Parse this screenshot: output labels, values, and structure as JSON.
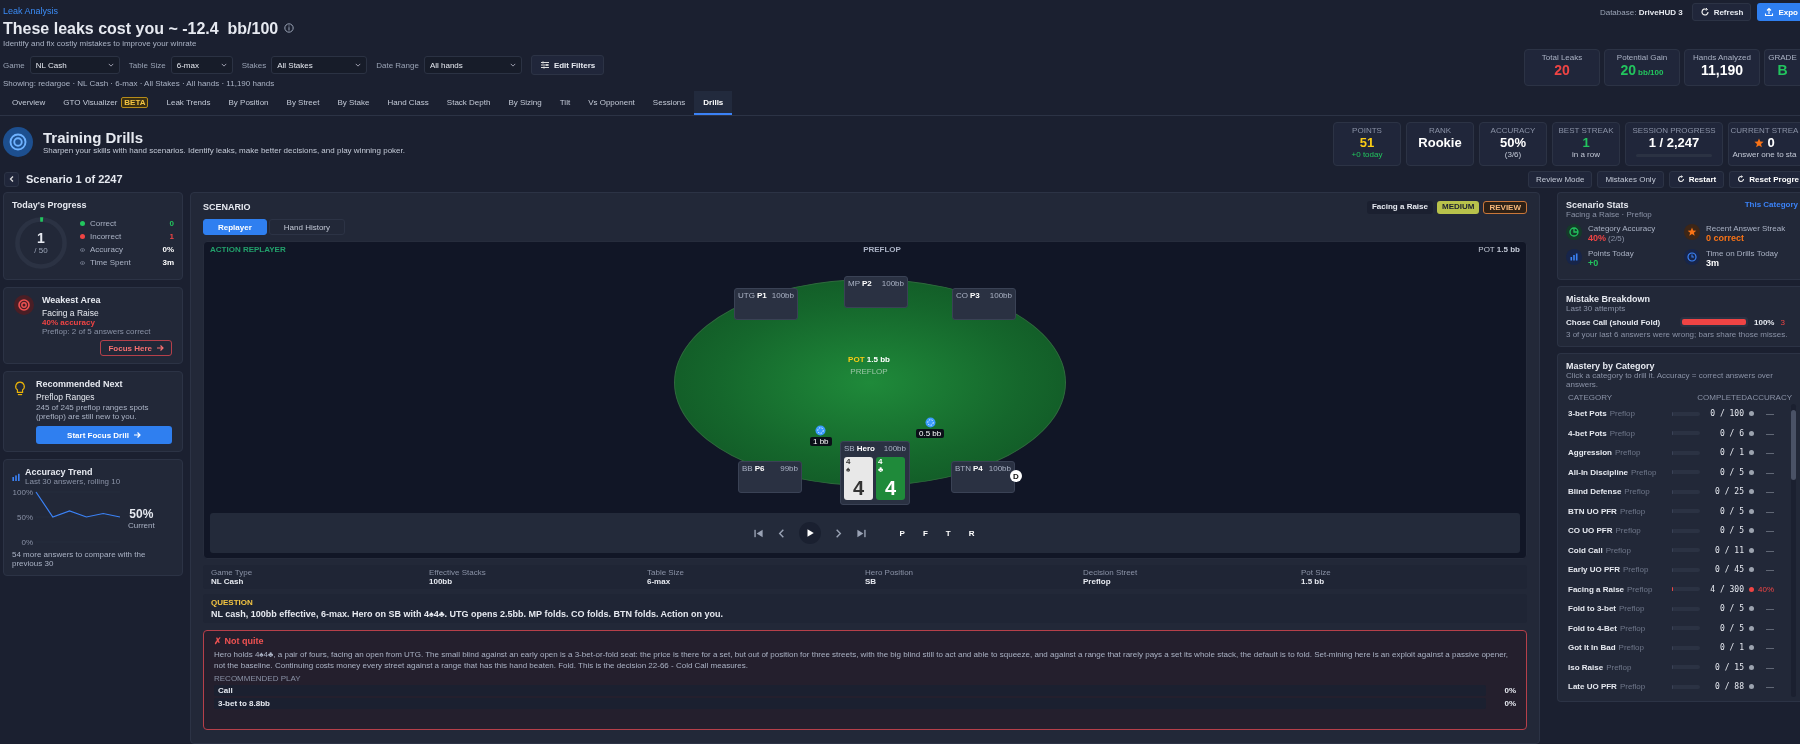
{
  "header": {
    "breadcrumb": "Leak Analysis",
    "title": "These leaks cost you ~ -12.4  bb/100",
    "subtitle": "Identify and fix costly mistakes to improve your winrate",
    "database_label": "Database:",
    "database_value": "DriveHUD 3",
    "refresh": "Refresh",
    "export": "Expo"
  },
  "filters": [
    {
      "label": "Game",
      "value": "NL Cash"
    },
    {
      "label": "Table Size",
      "value": "6-max"
    },
    {
      "label": "Stakes",
      "value": "All Stakes"
    },
    {
      "label": "Date Range",
      "value": "All hands"
    }
  ],
  "edit_filters": "Edit Filters",
  "showing": "Showing: redargoe · NL Cash · 6-max · All Stakes · All hands · 11,190 hands",
  "summary_stats": [
    {
      "label": "Total Leaks",
      "value": "20",
      "color": "#ef4444"
    },
    {
      "label": "Potential Gain",
      "value": "20",
      "unit": "bb/100",
      "color": "#22c55e"
    },
    {
      "label": "Hands Analyzed",
      "value": "11,190",
      "color": "#ffffff"
    },
    {
      "label": "GRADE",
      "value": "B",
      "color": "#22c55e"
    }
  ],
  "tabs": [
    {
      "label": "Overview",
      "selected": false
    },
    {
      "label": "GTO Visualizer",
      "badge": "BETA",
      "selected": false
    },
    {
      "label": "Leak Trends",
      "selected": false
    },
    {
      "label": "By Position",
      "selected": false
    },
    {
      "label": "By Street",
      "selected": false
    },
    {
      "label": "By Stake",
      "selected": false
    },
    {
      "label": "Hand Class",
      "selected": false
    },
    {
      "label": "Stack Depth",
      "selected": false
    },
    {
      "label": "By Sizing",
      "selected": false
    },
    {
      "label": "Tilt",
      "selected": false
    },
    {
      "label": "Vs Opponent",
      "selected": false
    },
    {
      "label": "Sessions",
      "selected": false
    },
    {
      "label": "Drills",
      "selected": true
    }
  ],
  "drills": {
    "title": "Training Drills",
    "subtitle": "Sharpen your skills with hand scenarios. Identify leaks, make better decisions, and play winning poker.",
    "stats": [
      {
        "label": "POINTS",
        "value": "51",
        "sub": "+0 today",
        "color": "#facc15"
      },
      {
        "label": "RANK",
        "value": "Rookie",
        "color": "#ffffff"
      },
      {
        "label": "ACCURACY",
        "value": "50%",
        "sub": "(3/6)",
        "color": "#ffffff"
      },
      {
        "label": "BEST STREAK",
        "value": "1",
        "sub": "in a row",
        "color": "#22c55e"
      },
      {
        "label": "SESSION PROGRESS",
        "value": "1 / 2,247",
        "level": 0.0004,
        "color": "#ffffff"
      },
      {
        "label": "CURRENT STREA",
        "value": "0",
        "sub": "Answer one to sta",
        "star": true,
        "color": "#ffffff"
      }
    ]
  },
  "scenario_nav": {
    "title": "Scenario 1 of 2247",
    "buttons": [
      {
        "label": "Review Mode",
        "icon": false
      },
      {
        "label": "Mistakes Only",
        "icon": false
      },
      {
        "label": "Restart",
        "icon": true
      },
      {
        "label": "Reset Progre",
        "icon": true
      }
    ]
  },
  "progress": {
    "title": "Today's Progress",
    "count": "1",
    "total": "/ 50",
    "level": 0.02,
    "stats": [
      {
        "label": "Correct",
        "value": "0",
        "kind": "dot",
        "color": "#22c55e"
      },
      {
        "label": "Incorrect",
        "value": "1",
        "kind": "dot",
        "color": "#ef4444"
      },
      {
        "label": "Accuracy",
        "value": "0%",
        "kind": "eye"
      },
      {
        "label": "Time Spent",
        "value": "3m",
        "kind": "eye"
      }
    ]
  },
  "weakest": {
    "title": "Weakest Area",
    "area": "Facing a Raise",
    "accuracy": "40% accuracy",
    "detail": "Preflop: 2 of 5 answers correct",
    "button": "Focus Here"
  },
  "recommended": {
    "title": "Recommended Next",
    "area": "Preflop Ranges",
    "detail": "245 of 245 preflop ranges spots (preflop) are still new to you.",
    "button": "Start Focus Drill"
  },
  "trend": {
    "title": "Accuracy Trend",
    "subtitle": "Last 30 answers, rolling 10",
    "current": "50%",
    "current_label": "Current",
    "note": "54 more answers to compare with the previous 30",
    "chart_data": {
      "type": "line",
      "series": [
        {
          "color": "#3b82f6",
          "values": [
            100,
            50,
            62,
            50,
            57,
            50
          ]
        }
      ],
      "ylim": [
        0,
        100
      ],
      "yticks": [
        {
          "value": 0,
          "label": "0%"
        },
        {
          "value": 50,
          "label": "50%"
        },
        {
          "value": 100,
          "label": "100%"
        }
      ]
    }
  },
  "scenario": {
    "title": "SCENARIO",
    "tags": [
      {
        "label": "Facing a Raise",
        "kind": "plain"
      },
      {
        "label": "MEDIUM",
        "kind": "difficulty"
      },
      {
        "label": "REVIEW",
        "kind": "review"
      }
    ],
    "views": [
      {
        "label": "Replayer",
        "selected": true
      },
      {
        "label": "Hand History",
        "selected": false
      }
    ],
    "replayer": {
      "label": "ACTION REPLAYER",
      "street": "PREFLOP",
      "pot_label": "POT",
      "pot_value": "1.5 bb",
      "table_pot_label": "POT",
      "table_pot_value": "1.5 bb",
      "table_street": "PREFLOP",
      "seats": [
        {
          "position": "UTG",
          "name": "P1",
          "stack": "100bb",
          "dealer": false,
          "hero": false
        },
        {
          "position": "MP",
          "name": "P2",
          "stack": "100bb",
          "dealer": false,
          "hero": false
        },
        {
          "position": "CO",
          "name": "P3",
          "stack": "100bb",
          "dealer": false,
          "hero": false
        },
        {
          "position": "BB",
          "name": "P6",
          "stack": "99bb",
          "dealer": false,
          "hero": false,
          "bet": "1 bb"
        },
        {
          "position": "SB",
          "name": "Hero",
          "stack": "100bb",
          "dealer": false,
          "hero": true,
          "bet": "0.5 bb"
        },
        {
          "position": "BTN",
          "name": "P4",
          "stack": "100bb",
          "dealer": true,
          "hero": false
        }
      ],
      "dealer": "D",
      "hero_cards": [
        {
          "corner_rank": "4",
          "suit": "♠",
          "rank": "4",
          "kind": "spade"
        },
        {
          "corner_rank": "4",
          "suit": "♣",
          "rank": "4",
          "kind": "club"
        }
      ],
      "streets": [
        "P",
        "F",
        "T",
        "R"
      ]
    },
    "info": [
      {
        "label": "Game Type",
        "value": "NL Cash"
      },
      {
        "label": "Effective Stacks",
        "value": "100bb"
      },
      {
        "label": "Table Size",
        "value": "6-max"
      },
      {
        "label": "Hero Position",
        "value": "SB"
      },
      {
        "label": "Decision Street",
        "value": "Preflop"
      },
      {
        "label": "Pot Size",
        "value": "1.5 bb"
      }
    ],
    "question_label": "QUESTION",
    "question": "NL cash, 100bb effective, 6-max. Hero on SB with 4♠4♣. UTG opens 2.5bb. MP folds. CO folds. BTN folds. Action on you.",
    "feedback": {
      "title": "✗ Not quite",
      "text": "Hero holds 4♠4♣, a pair of fours, facing an open from UTG. The small blind against an early open is a 3-bet-or-fold seat: the price is there for a set, but out of position for three streets, with the big blind still to act and able to squeeze, and against a range that rarely pays a set its whole stack, the default is to fold. Set-mining here is an exploit against a passive opener, not the baseline. Continuing costs money every street against a range that has this hand beaten. Fold. This is the decision 22-66 - Cold Call measures.",
      "recommended_label": "RECOMMENDED PLAY",
      "options": [
        {
          "label": "Call",
          "value": "0%"
        },
        {
          "label": "3-bet to 8.8bb",
          "value": "0%"
        }
      ]
    }
  },
  "scenario_stats": {
    "title": "Scenario Stats",
    "subtitle": "Facing a Raise · Preflop",
    "link": "This Category",
    "items": [
      {
        "label": "Category Accuracy",
        "value": "40%",
        "extra": "(2/5)",
        "kind": "pie",
        "color": "#ef4444"
      },
      {
        "label": "Recent Answer Streak",
        "value": "0 correct",
        "kind": "star",
        "color": "#f97316"
      },
      {
        "label": "Points Today",
        "value": "+0",
        "kind": "bars",
        "color": "#22c55e"
      },
      {
        "label": "Time on Drills Today",
        "value": "3m",
        "kind": "clock",
        "color": "#ffffff"
      }
    ]
  },
  "mistakes": {
    "title": "Mistake Breakdown",
    "subtitle": "Last 30 attempts",
    "rows": [
      {
        "label": "Chose Call (should Fold)",
        "level": 1,
        "percent": "100%",
        "count": "3"
      }
    ],
    "note": "3 of your last 6 answers were wrong; bars share those misses."
  },
  "mastery": {
    "title": "Mastery by Category",
    "subtitle": "Click a category to drill it. Accuracy = correct answers over answers.",
    "columns": [
      "CATEGORY",
      "COMPLETED",
      "ACCURACY"
    ],
    "rows": [
      {
        "name": "3-bet Pots",
        "street": "Preflop",
        "completed": "0 / 100",
        "level": 0,
        "color": "#9ca3af",
        "accuracy": "—"
      },
      {
        "name": "4-bet Pots",
        "street": "Preflop",
        "completed": "0 / 6",
        "level": 0,
        "color": "#9ca3af",
        "accuracy": "—"
      },
      {
        "name": "Aggression",
        "street": "Preflop",
        "completed": "0 / 1",
        "level": 0,
        "color": "#9ca3af",
        "accuracy": "—"
      },
      {
        "name": "All-In Discipline",
        "street": "Preflop",
        "completed": "0 / 5",
        "level": 0,
        "color": "#9ca3af",
        "accuracy": "—"
      },
      {
        "name": "Blind Defense",
        "street": "Preflop",
        "completed": "0 / 25",
        "level": 0,
        "color": "#9ca3af",
        "accuracy": "—"
      },
      {
        "name": "BTN UO PFR",
        "street": "Preflop",
        "completed": "0 / 5",
        "level": 0,
        "color": "#9ca3af",
        "accuracy": "—"
      },
      {
        "name": "CO UO PFR",
        "street": "Preflop",
        "completed": "0 / 5",
        "level": 0,
        "color": "#9ca3af",
        "accuracy": "—"
      },
      {
        "name": "Cold Call",
        "street": "Preflop",
        "completed": "0 / 11",
        "level": 0,
        "color": "#9ca3af",
        "accuracy": "—"
      },
      {
        "name": "Early UO PFR",
        "street": "Preflop",
        "completed": "0 / 45",
        "level": 0,
        "color": "#9ca3af",
        "accuracy": "—"
      },
      {
        "name": "Facing a Raise",
        "street": "Preflop",
        "completed": "4 / 300",
        "level": 0.013,
        "color": "#ef4444",
        "accuracy": "40%"
      },
      {
        "name": "Fold to 3-bet",
        "street": "Preflop",
        "completed": "0 / 5",
        "level": 0,
        "color": "#9ca3af",
        "accuracy": "—"
      },
      {
        "name": "Fold to 4-Bet",
        "street": "Preflop",
        "completed": "0 / 5",
        "level": 0,
        "color": "#9ca3af",
        "accuracy": "—"
      },
      {
        "name": "Got It In Bad",
        "street": "Preflop",
        "completed": "0 / 1",
        "level": 0,
        "color": "#9ca3af",
        "accuracy": "—"
      },
      {
        "name": "Iso Raise",
        "street": "Preflop",
        "completed": "0 / 15",
        "level": 0,
        "color": "#9ca3af",
        "accuracy": "—"
      },
      {
        "name": "Late UO PFR",
        "street": "Preflop",
        "completed": "0 / 88",
        "level": 0,
        "color": "#9ca3af",
        "accuracy": "—"
      }
    ]
  }
}
